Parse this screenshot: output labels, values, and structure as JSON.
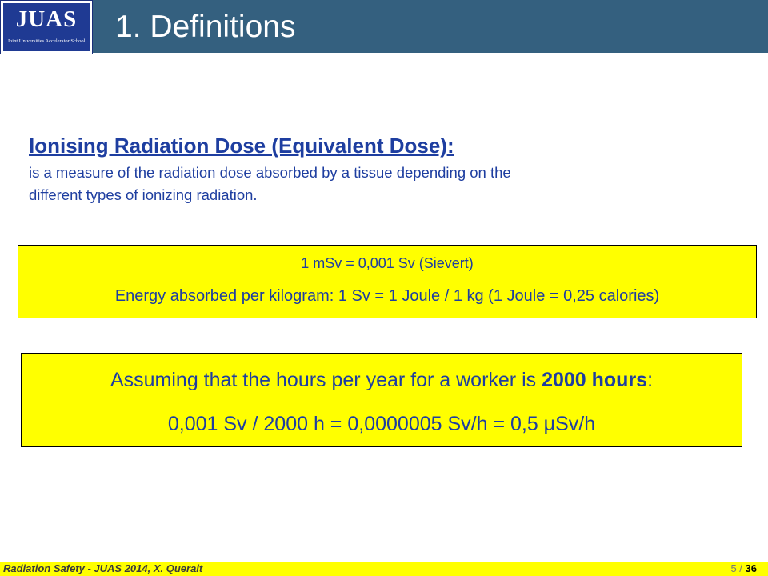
{
  "logo": {
    "word": "JUAS",
    "subtitle": "Joint Universities Accelerator School"
  },
  "header": {
    "title": "1. Definitions"
  },
  "definition": {
    "heading": "Ionising Radiation Dose (Equivalent Dose):",
    "body_line1": "is a measure of the radiation dose absorbed by a tissue depending on the",
    "body_line2": "different types of ionizing radiation."
  },
  "units_box": {
    "line1": "1 mSv = 0,001 Sv (Sievert)",
    "line2": "Energy absorbed per kilogram: 1 Sv = 1 Joule / 1 kg (1 Joule = 0,25 calories)"
  },
  "hours_box": {
    "line1_prefix": "Assuming that the hours per year for a worker is ",
    "line1_bold": "2000 hours",
    "line1_suffix": ":",
    "line2": "0,001 Sv / 2000 h = 0,0000005 Sv/h = 0,5 μSv/h"
  },
  "footer": {
    "text": "Radiation Safety - JUAS 2014, X. Queralt",
    "page_current": "5",
    "page_sep": " / ",
    "page_total": "36"
  },
  "colors": {
    "header_bg": "#34607f",
    "logo_bg": "#1f3a93",
    "text_blue": "#1e3ea0",
    "highlight": "#ffff00"
  }
}
